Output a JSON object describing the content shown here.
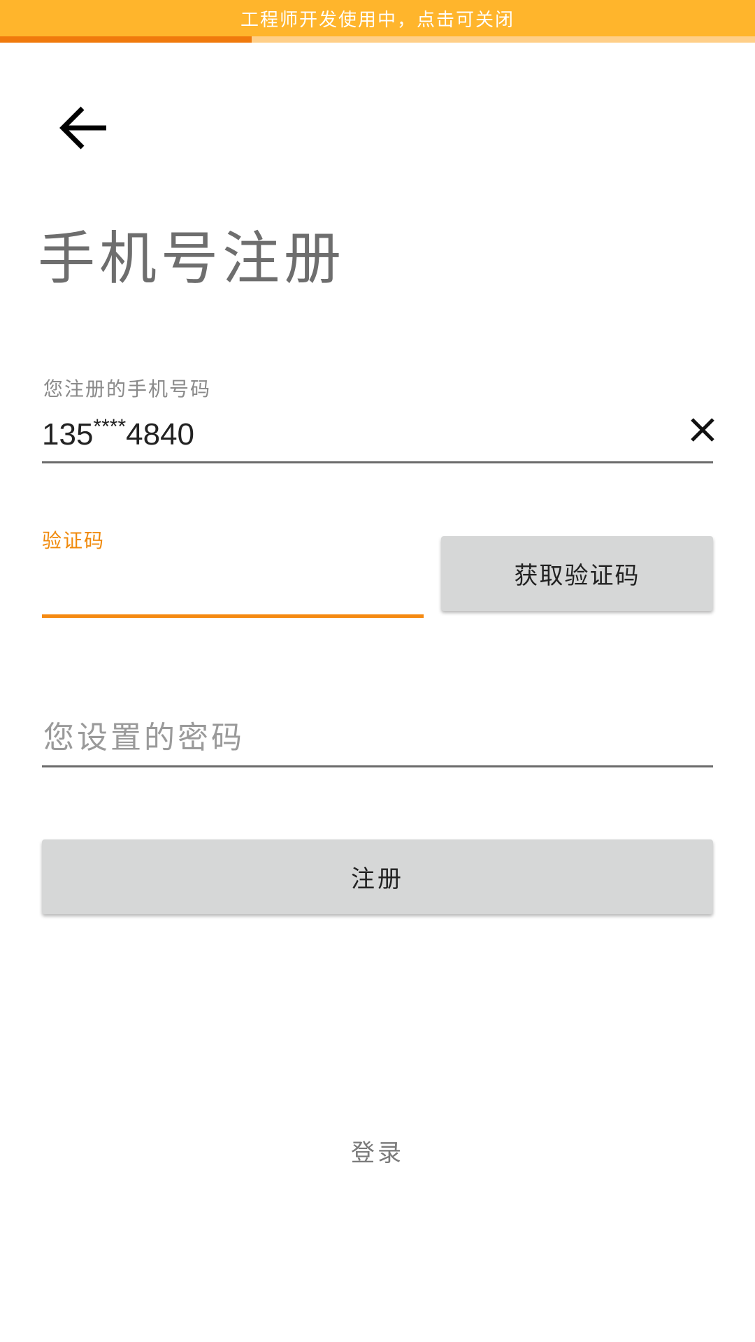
{
  "banner": {
    "text": "工程师开发使用中，点击可关闭",
    "progress_fraction": 0.333,
    "colors": {
      "background": "#FFB52C",
      "progress": "#F07A0C",
      "track": "#FFCF88"
    }
  },
  "header": {
    "back_icon": "arrow-left-icon"
  },
  "title": "手机号注册",
  "phone": {
    "label": "您注册的手机号码",
    "value_prefix": "135",
    "value_mask": "****",
    "value_suffix": "4840",
    "clear_icon": "close-icon"
  },
  "code": {
    "label": "验证码",
    "value": "",
    "button_label": "获取验证码",
    "accent_color": "#F58A12"
  },
  "password": {
    "placeholder": "您设置的密码",
    "value": ""
  },
  "register": {
    "label": "注册"
  },
  "login": {
    "label": "登录"
  }
}
